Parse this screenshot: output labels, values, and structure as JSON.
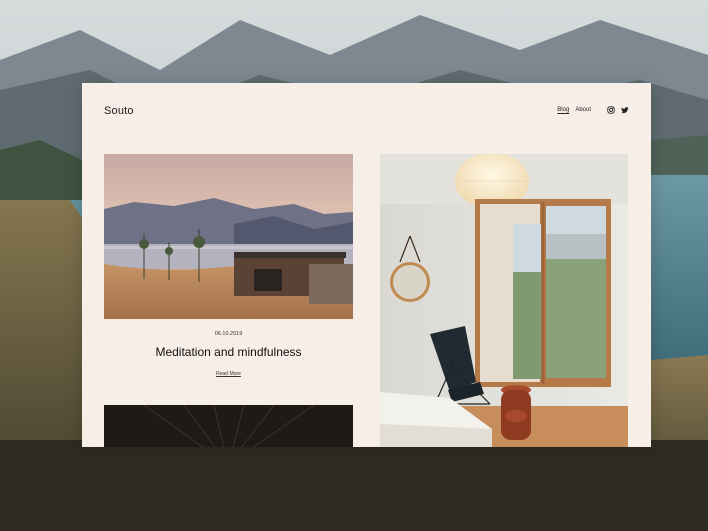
{
  "site": {
    "logo": "Souto"
  },
  "nav": {
    "items": [
      {
        "label": "Blog",
        "active": true
      },
      {
        "label": "About",
        "active": false
      }
    ],
    "social": [
      "instagram-icon",
      "twitter-icon"
    ]
  },
  "post": {
    "date": "06.10.2019",
    "title": "Meditation and mindfulness",
    "read_more": "Read More"
  },
  "colors": {
    "page_bg": "#f7eee8",
    "text": "#111111",
    "background_sky": "#c9d0d2"
  }
}
